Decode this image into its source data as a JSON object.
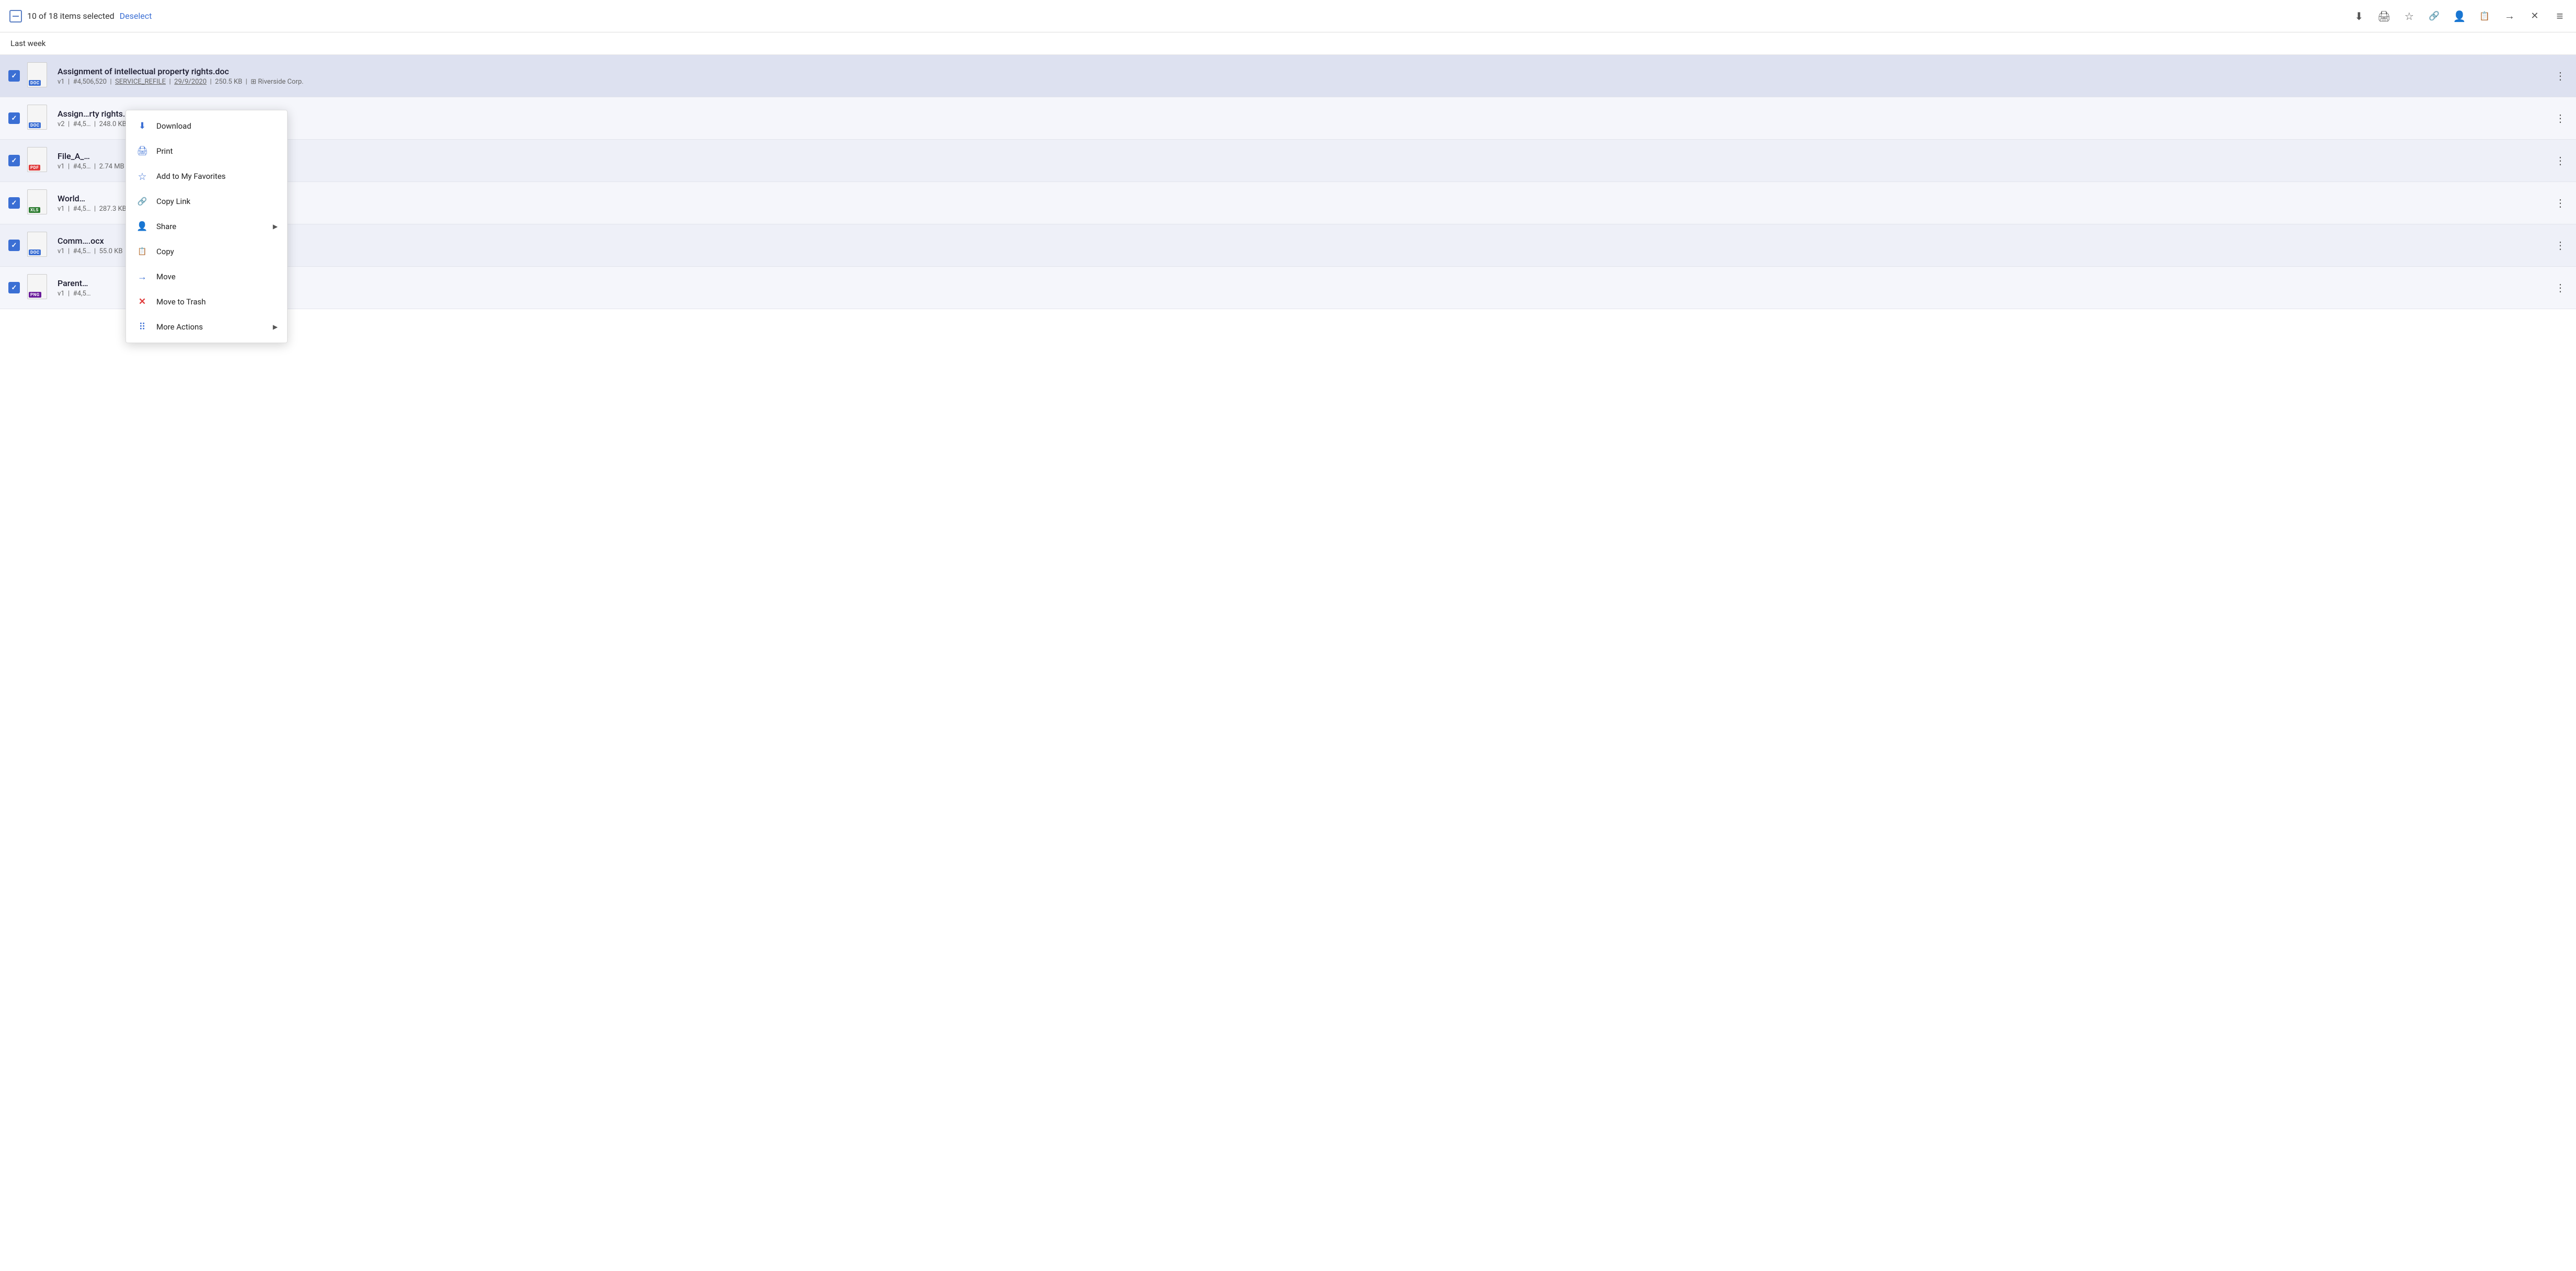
{
  "toolbar": {
    "selection_text": "10 of 18 items selected",
    "deselect_label": "Deselect",
    "icons": [
      "download",
      "print",
      "star",
      "link",
      "share",
      "copy",
      "move",
      "close",
      "list"
    ]
  },
  "section": {
    "label": "Last week"
  },
  "files": [
    {
      "id": 1,
      "name": "Assignment of intellectual property rights.doc",
      "meta": "v1  |  #4,506,520  |  SERVICE_REFILE  |  29/9/2020  |  250.5 KB  |  Riverside Corp.",
      "badge": "DOC",
      "badge_class": "badge-doc",
      "selected": true,
      "highlight": true
    },
    {
      "id": 2,
      "name": "Assign…rty rights.doc",
      "meta": "v2  |  #4,5…  |  248.0 KB  |  Riverside Corp.",
      "badge": "DOC",
      "badge_class": "badge-doc",
      "selected": true,
      "highlight": false
    },
    {
      "id": 3,
      "name": "File_A_…",
      "meta": "v1  |  #4,5…  |  2.74 MB  |  Riverside Corp.",
      "badge": "PDF",
      "badge_class": "badge-pdf",
      "selected": true,
      "highlight": false
    },
    {
      "id": 4,
      "name": "World…",
      "meta": "v1  |  #4,5…  |  287.3 KB  |  Riverside Corp.",
      "badge": "XLS",
      "badge_class": "badge-xls",
      "selected": true,
      "highlight": false
    },
    {
      "id": 5,
      "name": "Comm….ocx",
      "meta": "v1  |  #4,5…  |  55.0 KB  |  Riverside Corp.",
      "badge": "DOC",
      "badge_class": "badge-doc",
      "selected": true,
      "highlight": false
    },
    {
      "id": 6,
      "name": "Parent…",
      "meta": "v1  |  #4,5…",
      "badge": "PNG",
      "badge_class": "badge-png",
      "selected": true,
      "highlight": false
    }
  ],
  "context_menu": {
    "items": [
      {
        "id": "download",
        "label": "Download",
        "icon": "download",
        "has_arrow": false
      },
      {
        "id": "print",
        "label": "Print",
        "icon": "print",
        "has_arrow": false
      },
      {
        "id": "add-favorites",
        "label": "Add to My Favorites",
        "icon": "star",
        "has_arrow": false
      },
      {
        "id": "copy-link",
        "label": "Copy Link",
        "icon": "link",
        "has_arrow": false
      },
      {
        "id": "share",
        "label": "Share",
        "icon": "share",
        "has_arrow": true
      },
      {
        "id": "copy",
        "label": "Copy",
        "icon": "copy",
        "has_arrow": false
      },
      {
        "id": "move",
        "label": "Move",
        "icon": "move",
        "has_arrow": false
      },
      {
        "id": "move-trash",
        "label": "Move to Trash",
        "icon": "trash",
        "has_arrow": false
      },
      {
        "id": "more-actions",
        "label": "More Actions",
        "icon": "more-actions",
        "has_arrow": true
      }
    ]
  }
}
